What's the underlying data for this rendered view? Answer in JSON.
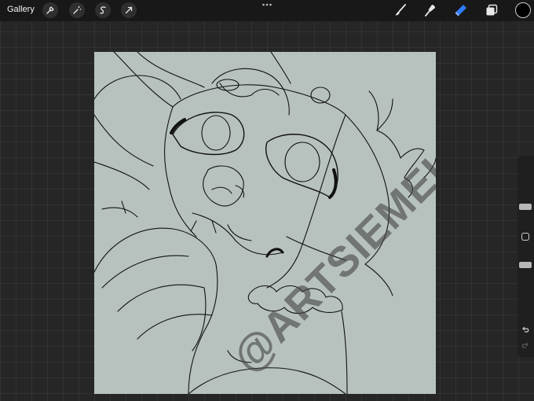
{
  "toolbar": {
    "gallery_label": "Gallery",
    "left_tools": [
      "wrench-icon",
      "magic-wand-icon",
      "selection-s-icon",
      "transform-arrow-icon"
    ],
    "right_tools": [
      "brush-icon",
      "smudge-icon",
      "eraser-icon",
      "layers-icon"
    ],
    "active_tool": "eraser",
    "active_color": "#000000",
    "accent_color": "#2f7dff"
  },
  "canvas": {
    "background_color": "#b7c2bf",
    "watermark": "@ARTSIEMELON"
  },
  "sidebar": {
    "brush_size_level": 0.35,
    "opacity_level": 0.72,
    "undo_icon": "undo-icon",
    "redo_icon": "redo-icon"
  }
}
